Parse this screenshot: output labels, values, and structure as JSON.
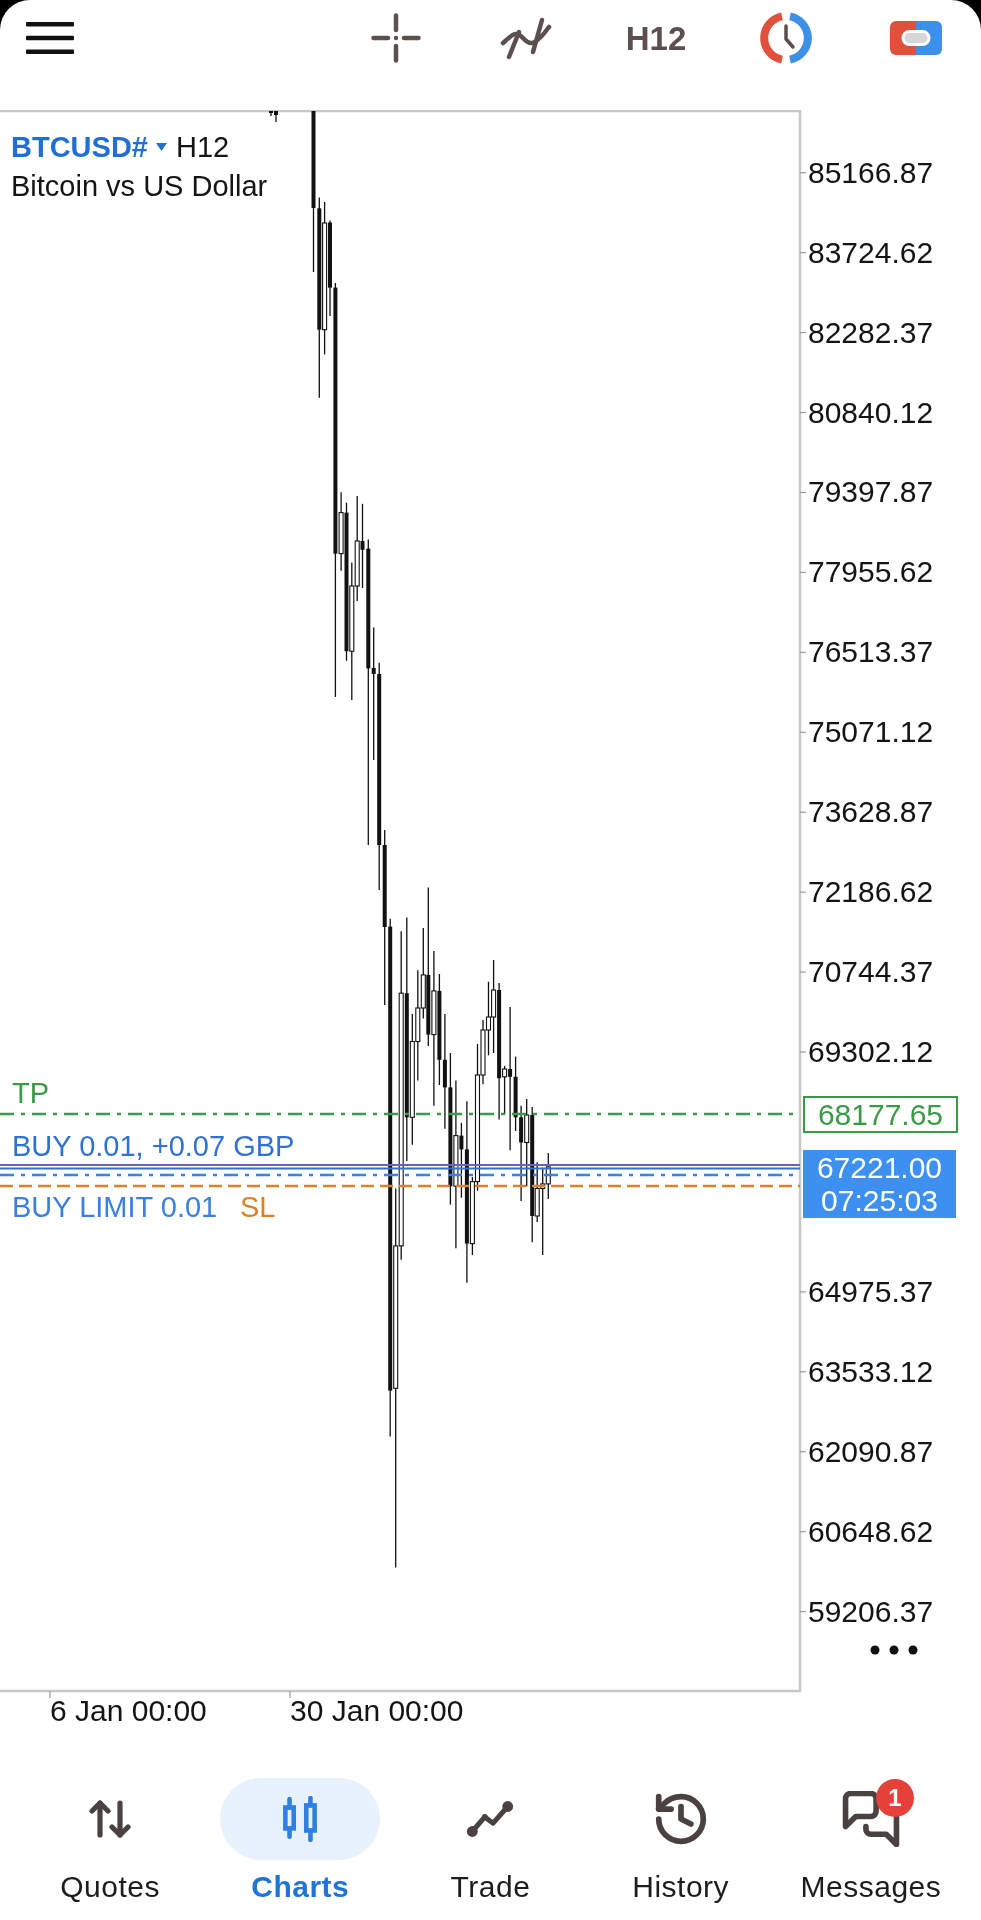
{
  "top_bar": {
    "timeframe": "H12"
  },
  "chart": {
    "symbol": "BTCUSD#",
    "timeframe": "H12",
    "description": "Bitcoin vs US Dollar",
    "price_axis": [
      "85166.87",
      "83724.62",
      "82282.37",
      "80840.12",
      "79397.87",
      "77955.62",
      "76513.37",
      "75071.12",
      "73628.87",
      "72186.62",
      "70744.37",
      "69302.12",
      "64975.37",
      "63533.12",
      "62090.87",
      "60648.62",
      "59206.37"
    ],
    "time_axis": [
      "6 Jan 00:00",
      "30 Jan 00:00"
    ],
    "order_lines": [
      {
        "kind": "take_profit",
        "label": "TP",
        "color": "#3a9a48",
        "price": "68177.65"
      },
      {
        "kind": "position",
        "label": "BUY 0.01, +0.07 GBP",
        "color": "#2f72d6"
      },
      {
        "kind": "pending",
        "label": "BUY LIMIT 0.01",
        "color": "#3b7fe0"
      },
      {
        "kind": "stop_loss",
        "label": "SL",
        "color": "#d9822b"
      }
    ],
    "bid": {
      "price": "67221.00",
      "countdown": "07:25:03"
    }
  },
  "bottom_nav": [
    {
      "label": "Quotes",
      "selected": false
    },
    {
      "label": "Charts",
      "selected": true
    },
    {
      "label": "Trade",
      "selected": false
    },
    {
      "label": "History",
      "selected": false
    },
    {
      "label": "Messages",
      "selected": false,
      "badge": "1"
    }
  ]
}
